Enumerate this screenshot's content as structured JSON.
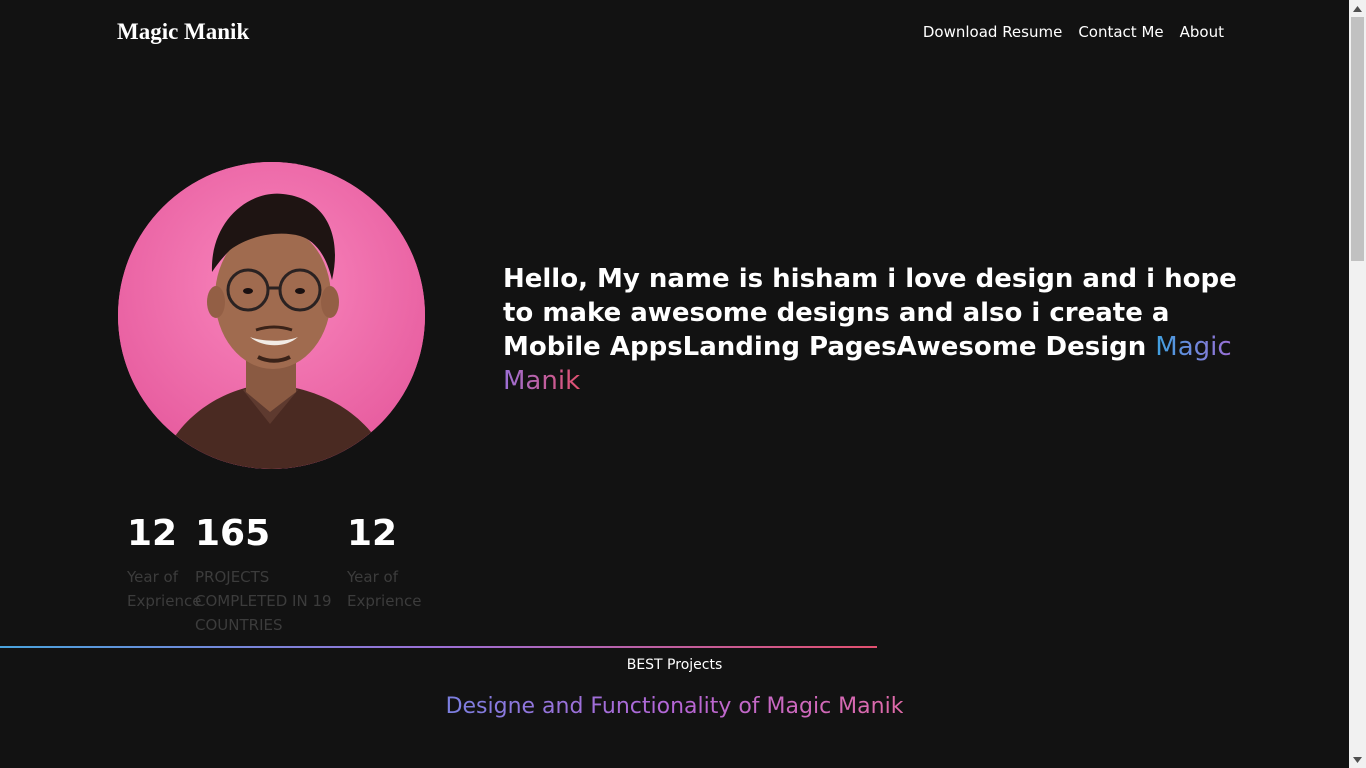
{
  "header": {
    "brand": "Magic Manik",
    "nav": [
      {
        "label": "Download Resume"
      },
      {
        "label": "Contact Me"
      },
      {
        "label": "About"
      }
    ]
  },
  "hero": {
    "intro_text": "Hello, My name is hisham i love design and i hope to make awesome designs and also i create a Mobile AppsLanding PagesAwesome Design ",
    "highlight": "Magic Manik"
  },
  "stats": [
    {
      "value": "12",
      "label": "Year of Exprience"
    },
    {
      "value": "165",
      "label": "PROJECTS COMPLETED IN 19 COUNTRIES"
    },
    {
      "value": "12",
      "label": "Year of Exprience"
    }
  ],
  "projects": {
    "label": "BEST Projects",
    "title": "Designe and Functionality of Magic Manik"
  },
  "colors": {
    "background": "#121212",
    "gradient_start": "#3fa1e0",
    "gradient_mid": "#9b6fd6",
    "gradient_end": "#e2506f",
    "avatar_bg": "#ef5fa0"
  }
}
